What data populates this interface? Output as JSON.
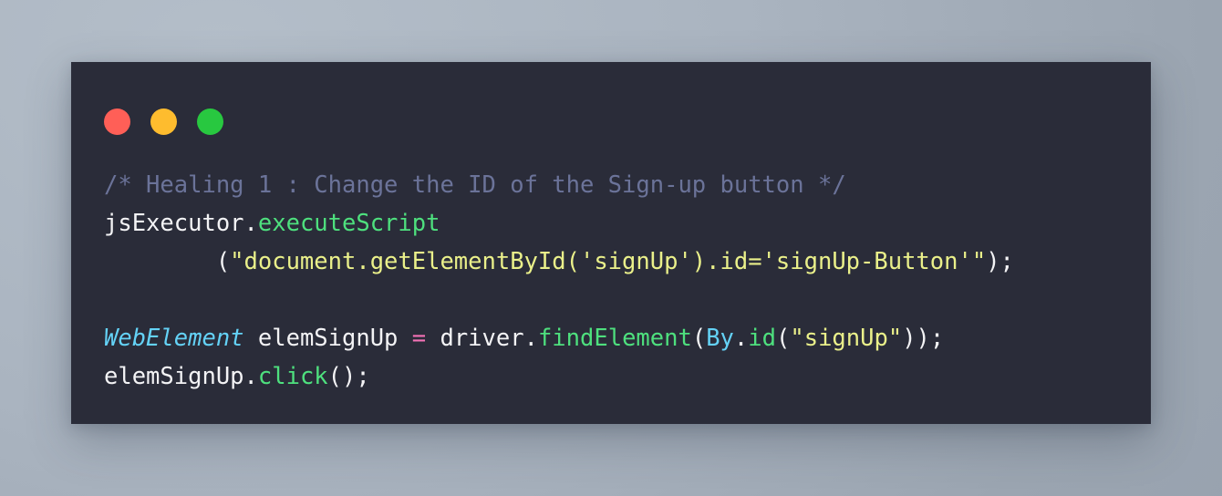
{
  "window": {
    "name": "code-snippet-window",
    "traffic_lights": [
      {
        "name": "close-button",
        "color": "#ff5f57"
      },
      {
        "name": "minimize-button",
        "color": "#febc2e"
      },
      {
        "name": "maximize-button",
        "color": "#28c840"
      }
    ],
    "background_color": "#2a2c39"
  },
  "page": {
    "background_color": "#aab4c0"
  },
  "code": {
    "language": "java",
    "full_text": "/* Healing 1 : Change the ID of the Sign-up button */\njsExecutor.executeScript\n        (\"document.getElementById('signUp').id='signUp-Button'\");\n\nWebElement elemSignUp = driver.findElement(By.id(\"signUp\"));\nelemSignUp.click();",
    "lines": [
      {
        "id": "line-1-comment",
        "tokens": [
          {
            "text": "/* Healing 1 : Change the ID of the Sign-up button */",
            "type": "comment"
          }
        ]
      },
      {
        "id": "line-2-jsexecutor",
        "tokens": [
          {
            "text": "jsExecutor.",
            "type": "plain"
          },
          {
            "text": "executeScript",
            "type": "fn"
          }
        ]
      },
      {
        "id": "line-3-script-string",
        "tokens": [
          {
            "text": "        (",
            "type": "plain"
          },
          {
            "text": "\"document.getElementById('signUp').id='signUp-Button'\"",
            "type": "string"
          },
          {
            "text": ");",
            "type": "plain"
          }
        ]
      },
      {
        "id": "line-4-blank",
        "tokens": [
          {
            "text": " ",
            "type": "plain"
          }
        ]
      },
      {
        "id": "line-5-webelement",
        "tokens": [
          {
            "text": "WebElement",
            "type": "type"
          },
          {
            "text": " elemSignUp ",
            "type": "plain"
          },
          {
            "text": "=",
            "type": "operator"
          },
          {
            "text": " driver.",
            "type": "plain"
          },
          {
            "text": "findElement",
            "type": "fn"
          },
          {
            "text": "(",
            "type": "plain"
          },
          {
            "text": "By",
            "type": "class"
          },
          {
            "text": ".",
            "type": "plain"
          },
          {
            "text": "id",
            "type": "fn"
          },
          {
            "text": "(",
            "type": "plain"
          },
          {
            "text": "\"signUp\"",
            "type": "string"
          },
          {
            "text": "));",
            "type": "plain"
          }
        ]
      },
      {
        "id": "line-6-click",
        "tokens": [
          {
            "text": "elemSignUp.",
            "type": "plain"
          },
          {
            "text": "click",
            "type": "fn"
          },
          {
            "text": "();",
            "type": "plain"
          }
        ]
      }
    ],
    "colors": {
      "comment": "#6b7399",
      "plain": "#f3f3f5",
      "function": "#4ee07e",
      "string": "#eaf08a",
      "type": "#64d2f6",
      "operator": "#f472b6"
    }
  }
}
